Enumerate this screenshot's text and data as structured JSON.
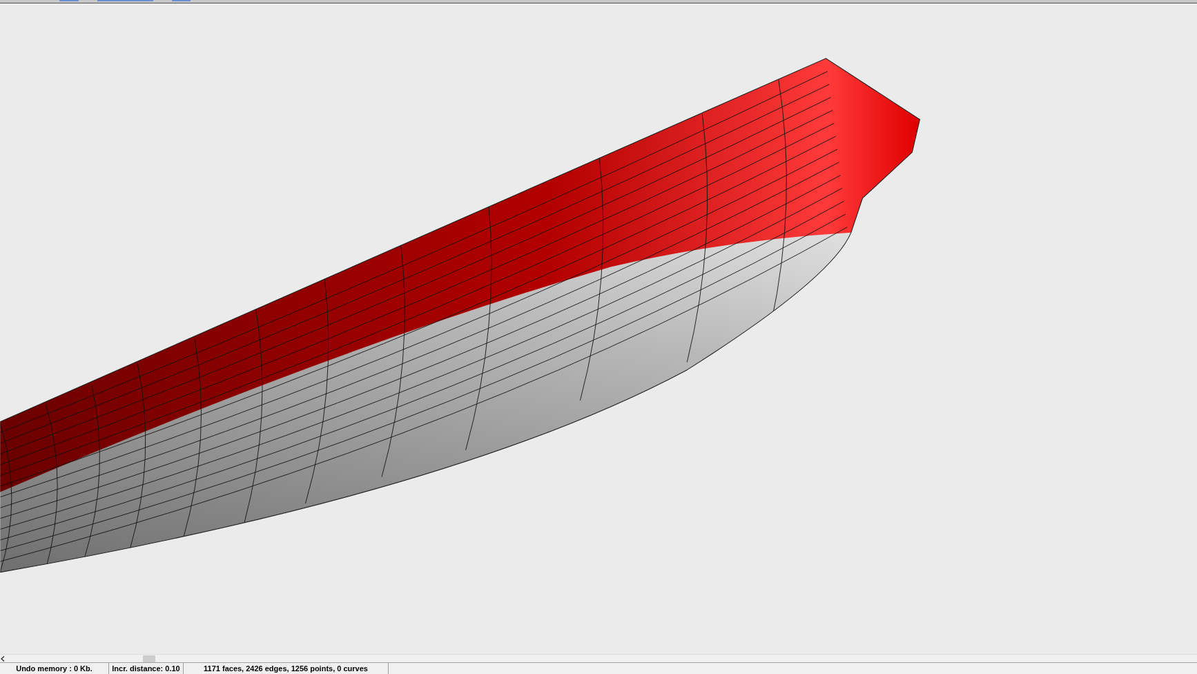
{
  "status_bar": [
    {
      "text": "Undo memory : 0 Kb."
    },
    {
      "text": "Incr. distance: 0.10"
    },
    {
      "text": "1171 faces, 2426 edges, 1256 points, 0 curves"
    }
  ]
}
